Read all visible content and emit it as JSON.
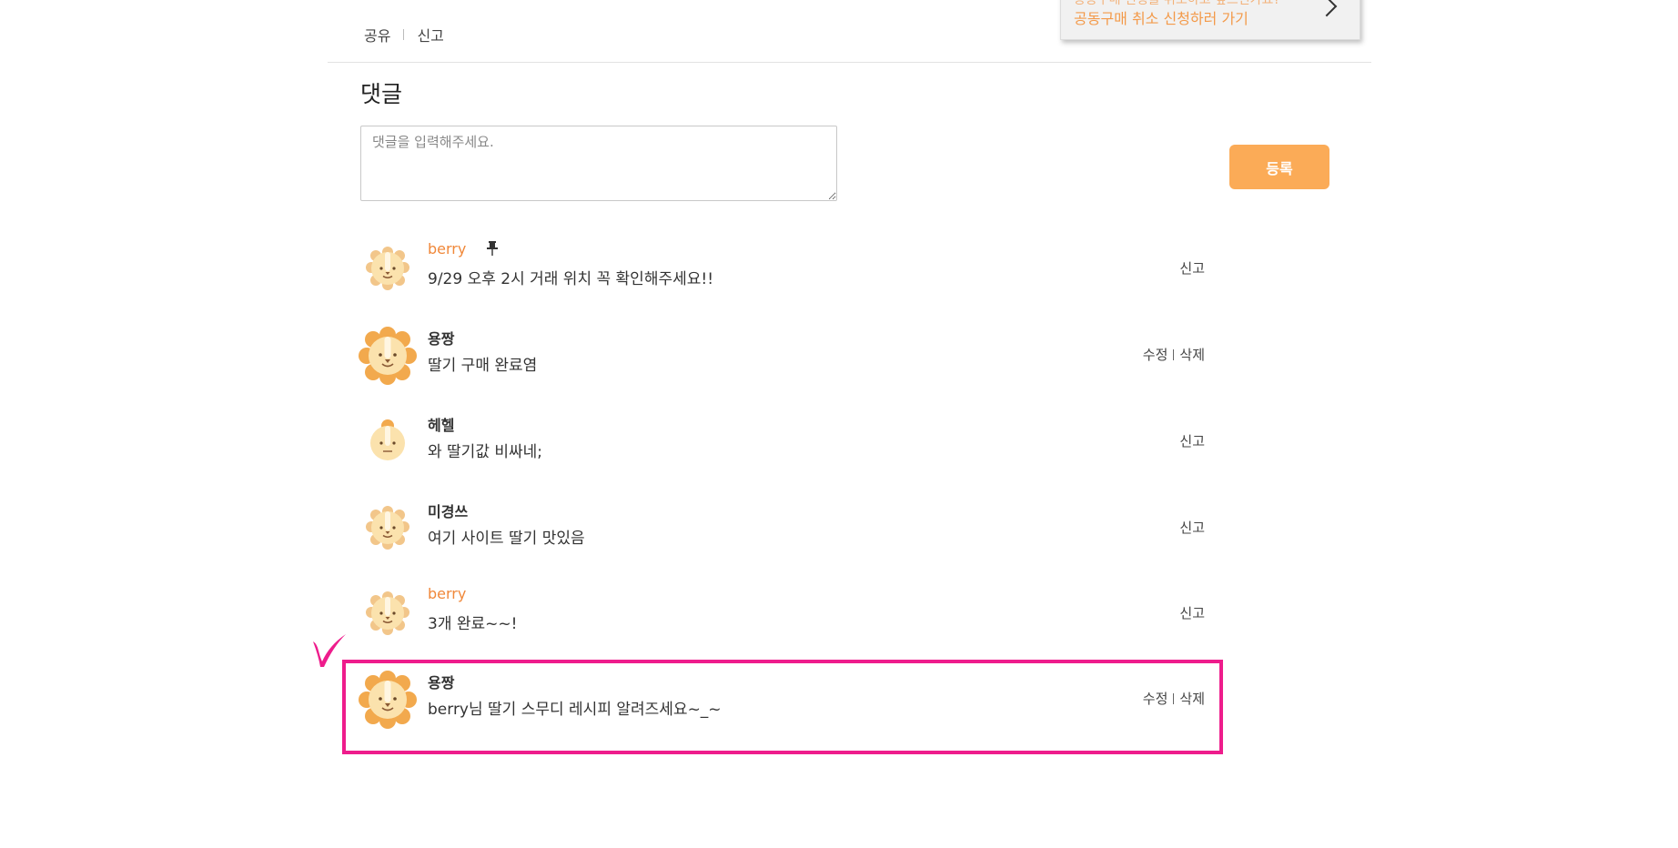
{
  "post_actions": {
    "share": "공유",
    "report": "신고"
  },
  "cancel_card": {
    "line1": "공동구매 신청을 취소하고 싶으신가요?",
    "line2": "공동구매 취소 신청하러 가기"
  },
  "comments": {
    "title": "댓글",
    "input_placeholder": "댓글을 입력해주세요.",
    "submit_label": "등록",
    "items": [
      {
        "author": "berry",
        "text": "9/29 오후 2시 거래 위치 꼭 확인해주세요!!",
        "report": "신고",
        "pinned": true,
        "is_op": true
      },
      {
        "author": "용짱",
        "text": "딸기 구매 완료염",
        "edit": "수정",
        "delete": "삭제"
      },
      {
        "author": "헤헬",
        "text": "와 딸기값 비싸네;",
        "report": "신고"
      },
      {
        "author": "미경쓰",
        "text": "여기 사이트 딸기 맛있음",
        "report": "신고"
      },
      {
        "author": "berry",
        "text": "3개 완료~~!",
        "report": "신고",
        "is_op": true
      },
      {
        "author": "용짱",
        "text": "berry님 딸기 스무디 레시피 알려즈세요~_~",
        "edit": "수정",
        "delete": "삭제"
      }
    ]
  },
  "icons": {
    "pin": "pushpin-icon",
    "avatar": "lion-avatar-icon",
    "chevron": "chevron-right-icon",
    "check": "checkmark-icon"
  },
  "colors": {
    "accent": "#fbab57",
    "op_name": "#f0883a",
    "highlight": "#ee1c8c",
    "lion_mane": "#f2a94d",
    "lion_face": "#fbe2ad"
  }
}
